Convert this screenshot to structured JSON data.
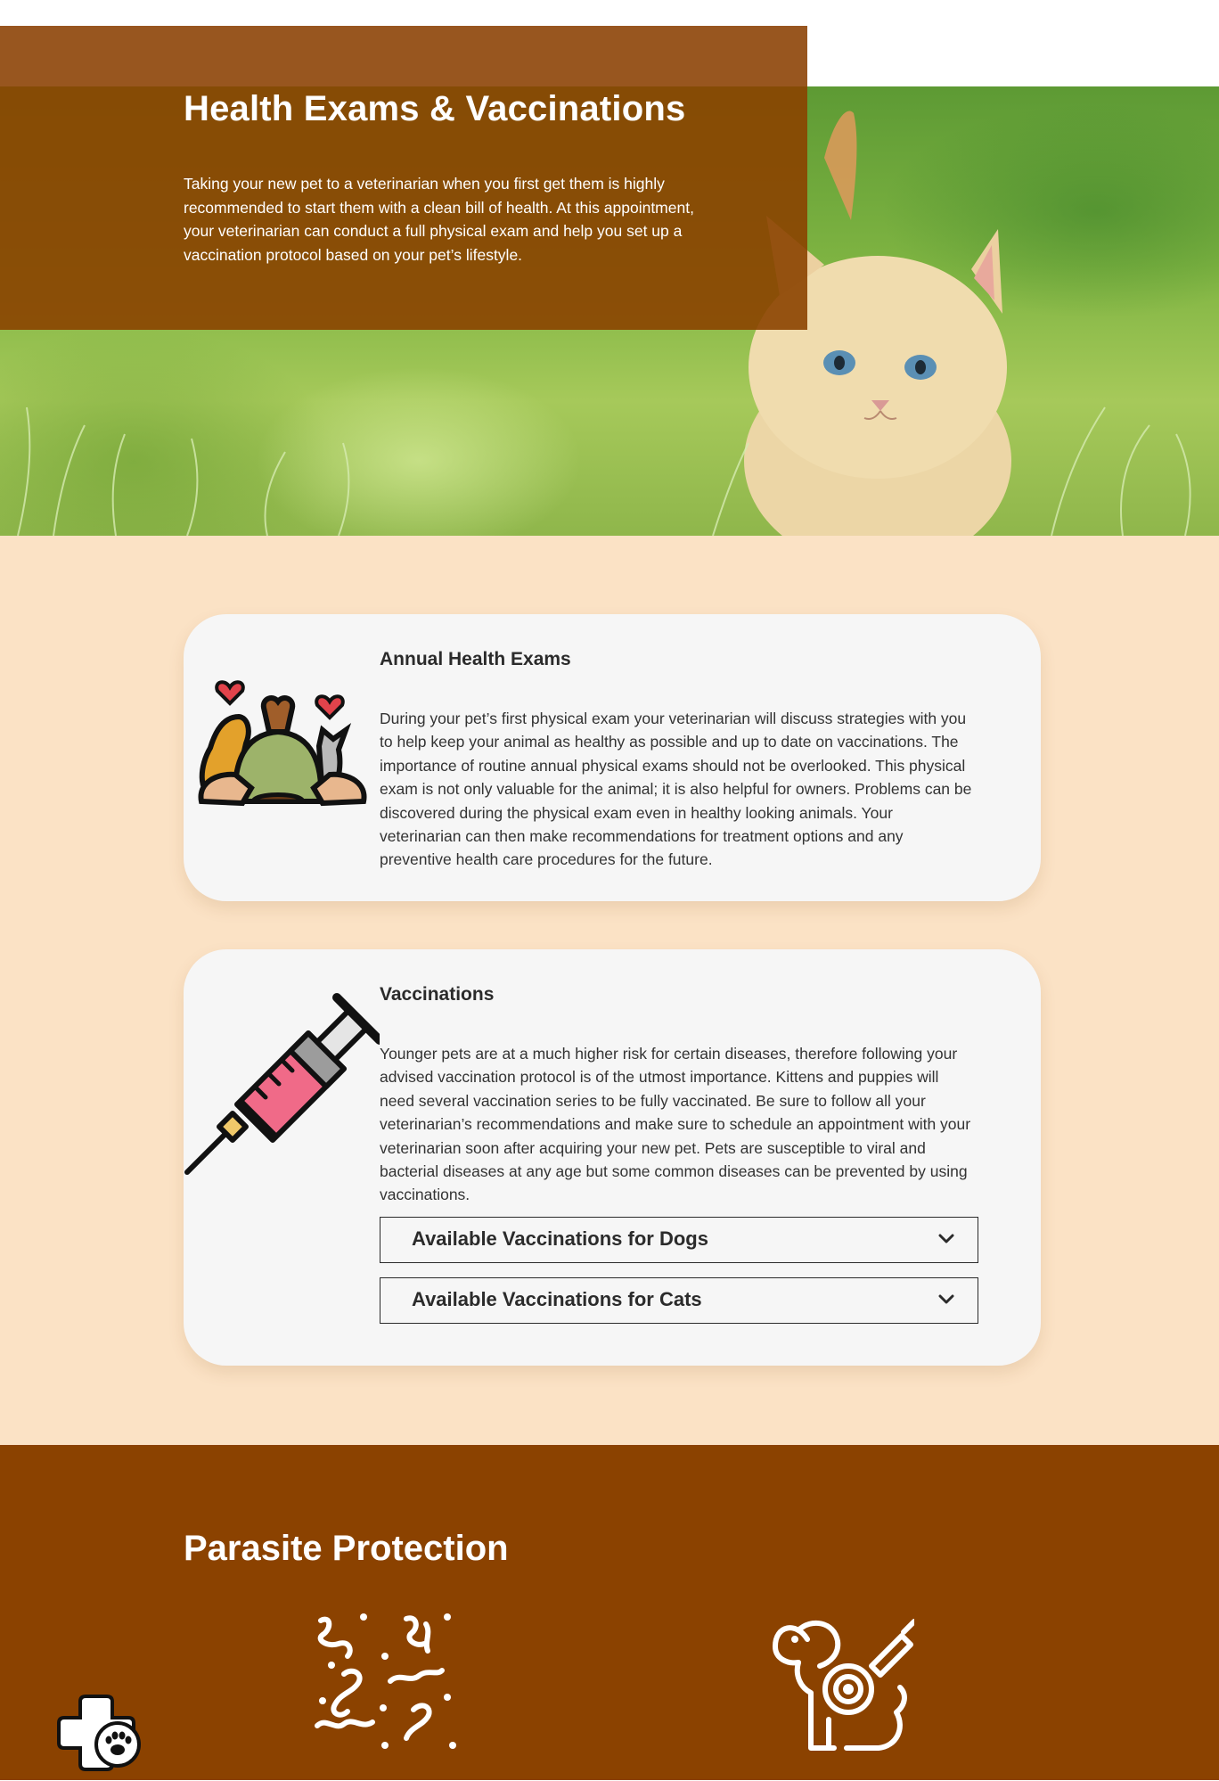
{
  "hero": {
    "title": "Health Exams & Vaccinations",
    "description": "Taking your new pet to a veterinarian when you first get them is highly recommended to start them with a clean bill of health. At this appointment, your veterinarian can conduct a full physical exam and help you set up a vaccination protocol based on your pet’s lifestyle.",
    "image_alt": "kitten-in-grass"
  },
  "annual": {
    "icon": "pet-owner-hug-icon",
    "title": "Annual Health Exams",
    "text": "During your pet’s first physical exam your veterinarian will discuss strategies with you to help keep your animal as healthy as possible and up to date on vaccinations. The importance of routine annual physical exams should not be overlooked. This physical exam is not only valuable for the animal; it is also helpful for owners. Problems can be discovered during the physical exam even in healthy looking animals. Your veterinarian can then make recommendations for treatment options and any preventive health care procedures for the future."
  },
  "vaccinations": {
    "icon": "syringe-icon",
    "title": "Vaccinations",
    "text": "Younger pets are at a much higher risk for certain diseases, therefore following your advised vaccination protocol is of the utmost importance. Kittens and puppies will need several vaccination series to be fully vaccinated. Be sure to follow all your veterinarian’s recommendations and make sure to schedule an appointment with your veterinarian soon after acquiring your new pet. Pets are susceptible to viral and bacterial diseases at any age but some common diseases can be prevented by using vaccinations.",
    "accordions": [
      {
        "label": "Available Vaccinations for Dogs",
        "expanded": false
      },
      {
        "label": "Available Vaccinations for Cats",
        "expanded": false
      }
    ]
  },
  "parasite": {
    "title": "Parasite Protection",
    "icons": [
      "worms-icon",
      "dog-tick-treatment-icon"
    ]
  },
  "floating_widget": {
    "icon": "medical-paw-icon"
  },
  "colors": {
    "brand_brown": "#8b4200",
    "peach_background": "#fbe2c5",
    "card_background": "#f6f6f6",
    "text_dark": "#2b2b2b"
  }
}
